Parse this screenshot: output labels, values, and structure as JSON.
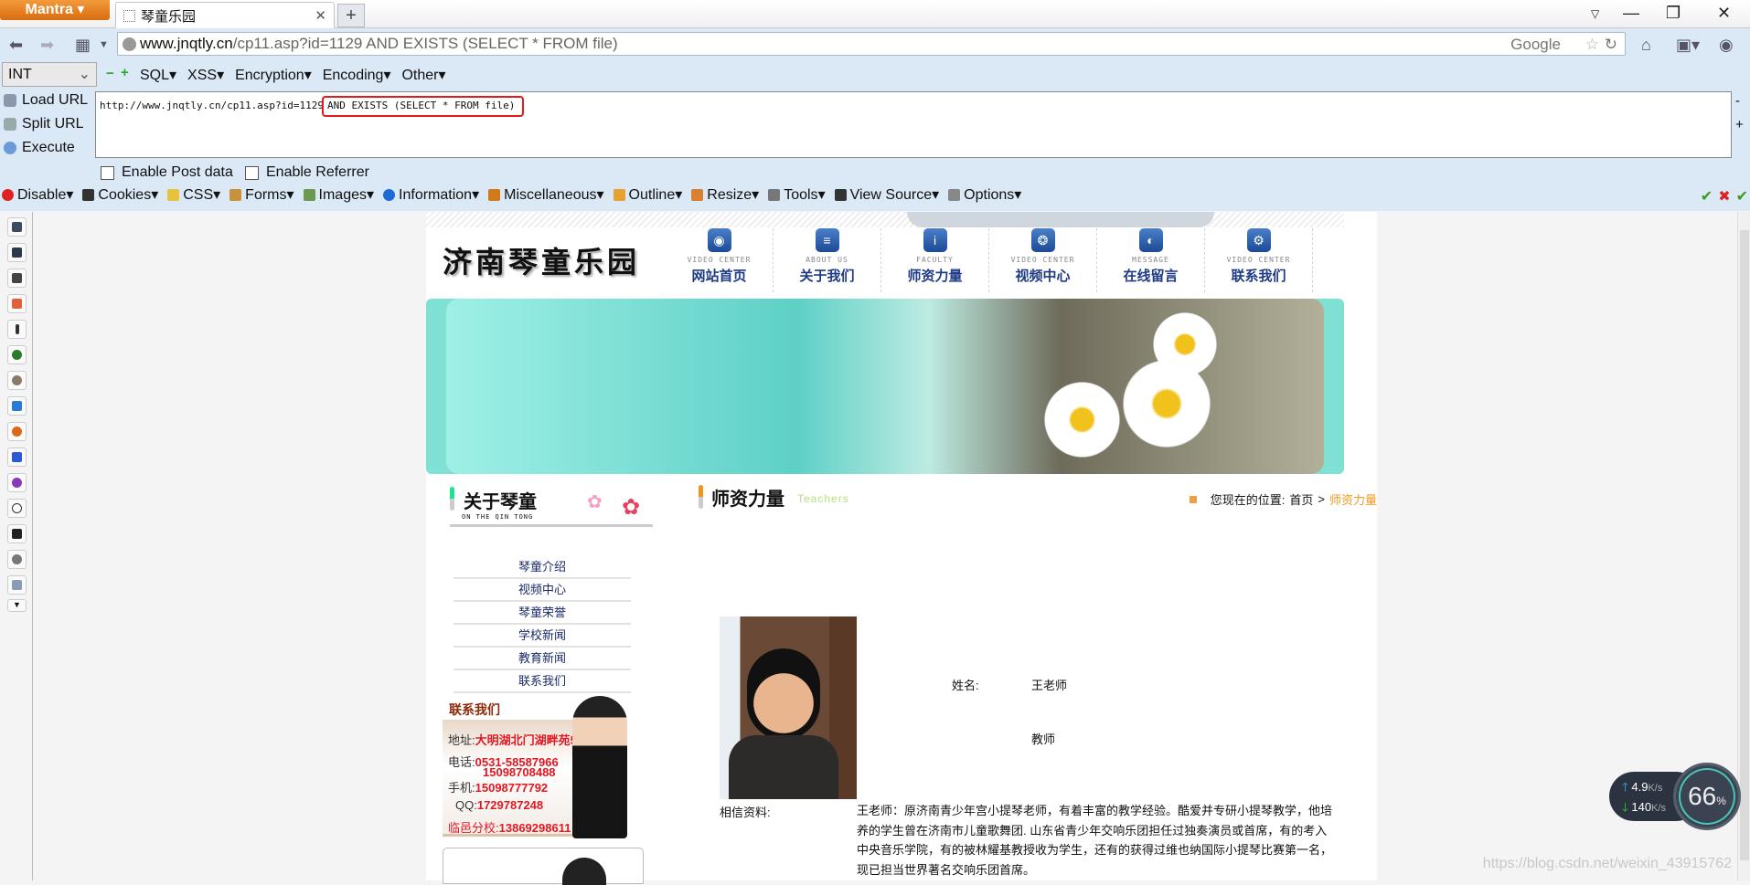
{
  "browser": {
    "menu_button": "Mantra",
    "tab_title": "琴童乐园",
    "new_tab": "+",
    "url_domain": "www.jnqtly.cn",
    "url_rest": "/cp11.asp?id=1129 AND EXISTS (SELECT * FROM file)",
    "search_engine": "Google"
  },
  "hackbar": {
    "type_select": "INT",
    "menus": [
      "SQL",
      "XSS",
      "Encryption",
      "Encoding",
      "Other"
    ],
    "actions": [
      "Load URL",
      "Split URL",
      "Execute"
    ],
    "url_prefix": "http://www.jnqtly.cn/cp11.asp?id=1129",
    "url_highlight": "AND EXISTS (SELECT * FROM file)",
    "enable_post": "Enable Post data",
    "enable_referrer": "Enable Referrer",
    "highlight_color": "#e21a1a"
  },
  "webdev_toolbar": [
    "Disable",
    "Cookies",
    "CSS",
    "Forms",
    "Images",
    "Information",
    "Miscellaneous",
    "Outline",
    "Resize",
    "Tools",
    "View Source",
    "Options"
  ],
  "site": {
    "logo": "济南琴童乐园",
    "nav": [
      {
        "en": "VIDEO CENTER",
        "zh": "网站首页",
        "icon": "disc-icon"
      },
      {
        "en": "ABOUT US",
        "zh": "关于我们",
        "icon": "document-icon"
      },
      {
        "en": "FACULTY",
        "zh": "师资力量",
        "icon": "info-icon"
      },
      {
        "en": "VIDEO CENTER",
        "zh": "视频中心",
        "icon": "film-icon"
      },
      {
        "en": "MESSAGE",
        "zh": "在线留言",
        "icon": "globe-icon"
      },
      {
        "en": "VIDEO CENTER",
        "zh": "联系我们",
        "icon": "gears-icon"
      }
    ],
    "about_title": "关于琴童",
    "about_en": "ON THE QIN TONG",
    "section_title": "师资力量",
    "section_en": "Teachers",
    "breadcrumb": {
      "label": "您现在的位置:",
      "home": "首页",
      "sep": ">",
      "current": "师资力量"
    },
    "menu": [
      "琴童介绍",
      "视频中心",
      "琴童荣誉",
      "学校新闻",
      "教育新闻",
      "联系我们"
    ],
    "contact": {
      "title": "联系我们",
      "address_label": "地址:",
      "address": "大明湖北门湖畔苑5号楼",
      "phone_label": "电话:",
      "phone1": "0531-58587966",
      "phone2": "15098708488",
      "mobile_label": "手机:",
      "mobile": "15098777792",
      "qq_label": "QQ:",
      "qq": "1729787248",
      "branch_label": "临邑分校:",
      "branch": "13869298611"
    },
    "teacher": {
      "name_label": "姓名:",
      "name": "王老师",
      "title": "教师",
      "bio_label": "相信资料:",
      "bio": "王老师：原济南青少年宫小提琴老师，有着丰富的教学经验。酷爱并专研小提琴教学，他培养的学生曾在济南市儿童歌舞团. 山东省青少年交响乐团担任过独奏演员或首席，有的考入中央音乐学院，有的被林耀基教授收为学生，还有的获得过维也纳国际小提琴比赛第一名，现已担当世界著名交响乐团首席。"
    }
  },
  "net_widget": {
    "up": "4.9",
    "down": "140",
    "unit": "K/s",
    "percent": "66",
    "percent_sign": "%"
  },
  "watermark": "https://blog.csdn.net/weixin_43915762"
}
